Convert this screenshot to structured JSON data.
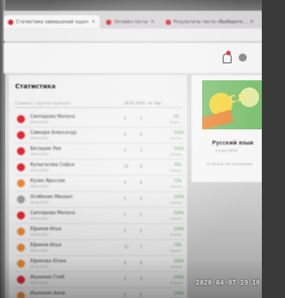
{
  "browser": {
    "tabs": [
      {
        "label": "Статистика завершений задач",
        "active": true
      },
      {
        "label": "Онлайн-тесты",
        "active": false
      },
      {
        "label": "Результаты теста «Выберите...",
        "active": false
      }
    ]
  },
  "page": {
    "title": "Статистика",
    "filter_placeholder": "Сравнить с другим периодом",
    "filter_date": "30.03.2020 - по 7дн"
  },
  "students": [
    {
      "name": "Сиппарова Милана",
      "date": "06.04.2020",
      "n1": "4",
      "n2": "3",
      "pct": "0%",
      "label": "Норма",
      "avatar": "#e0282d"
    },
    {
      "name": "Сивкора Александр",
      "date": "06.04.2020",
      "n1": "8",
      "n2": "8",
      "pct": "100%",
      "label": "Отлично",
      "avatar": "#e0282d"
    },
    {
      "name": "Беташев Лев",
      "date": "06.04.2020",
      "n1": "3",
      "n2": "3",
      "pct": "100%",
      "label": "Отлично",
      "avatar": "#e0282d"
    },
    {
      "name": "Кулыгасова Софья",
      "date": "06.04.2020",
      "n1": "14",
      "n2": "8",
      "pct": "76%",
      "label": "Хорошо",
      "avatar": "#e0282d"
    },
    {
      "name": "Кузин Ярослав",
      "date": "06.04.2020",
      "n1": "9",
      "n2": "8",
      "pct": "72%",
      "label": "Отлично",
      "avatar": "#e98a39"
    },
    {
      "name": "Огибенин Михаил",
      "date": "06.04.2020",
      "n1": "5",
      "n2": "4",
      "pct": "100%",
      "label": "Отлично",
      "avatar": "#9e9e9e"
    },
    {
      "name": "Сиппарова Милана",
      "date": "06.04.2020",
      "n1": "1",
      "n2": "1",
      "pct": "100%",
      "label": "Отлично",
      "avatar": "#e0282d"
    },
    {
      "name": "Ефимов Илья",
      "date": "06.04.2020",
      "n1": "2",
      "n2": "2",
      "pct": "100%",
      "label": "Отлично",
      "avatar": "#e98a39"
    },
    {
      "name": "Ефимов Илья",
      "date": "06.04.2020",
      "n1": "11",
      "n2": "7",
      "pct": "73%",
      "label": "Хорошо",
      "avatar": "#e98a39"
    },
    {
      "name": "Ефимова Юлия",
      "date": "06.04.2020",
      "n1": "6",
      "n2": "6",
      "pct": "100%",
      "label": "Отлично",
      "avatar": "#e98a39"
    },
    {
      "name": "Ишкинин Глеб",
      "date": "06.04.2020",
      "n1": "3",
      "n2": "3",
      "pct": "100%",
      "label": "Отлично",
      "avatar": "#e0282d"
    },
    {
      "name": "Ишкинин Анна",
      "date": "06.04.2020",
      "n1": "2",
      "n2": "2",
      "pct": "100%",
      "label": "Отлично",
      "avatar": "#e98a39"
    }
  ],
  "side_card": {
    "image_word": "СЛ",
    "subject": "Русский язык",
    "grade": "3 класс МПЭС",
    "meta": "45 уроков, 491 упражнение"
  },
  "photo": {
    "timestamp": "2020-04-07 19:16"
  }
}
